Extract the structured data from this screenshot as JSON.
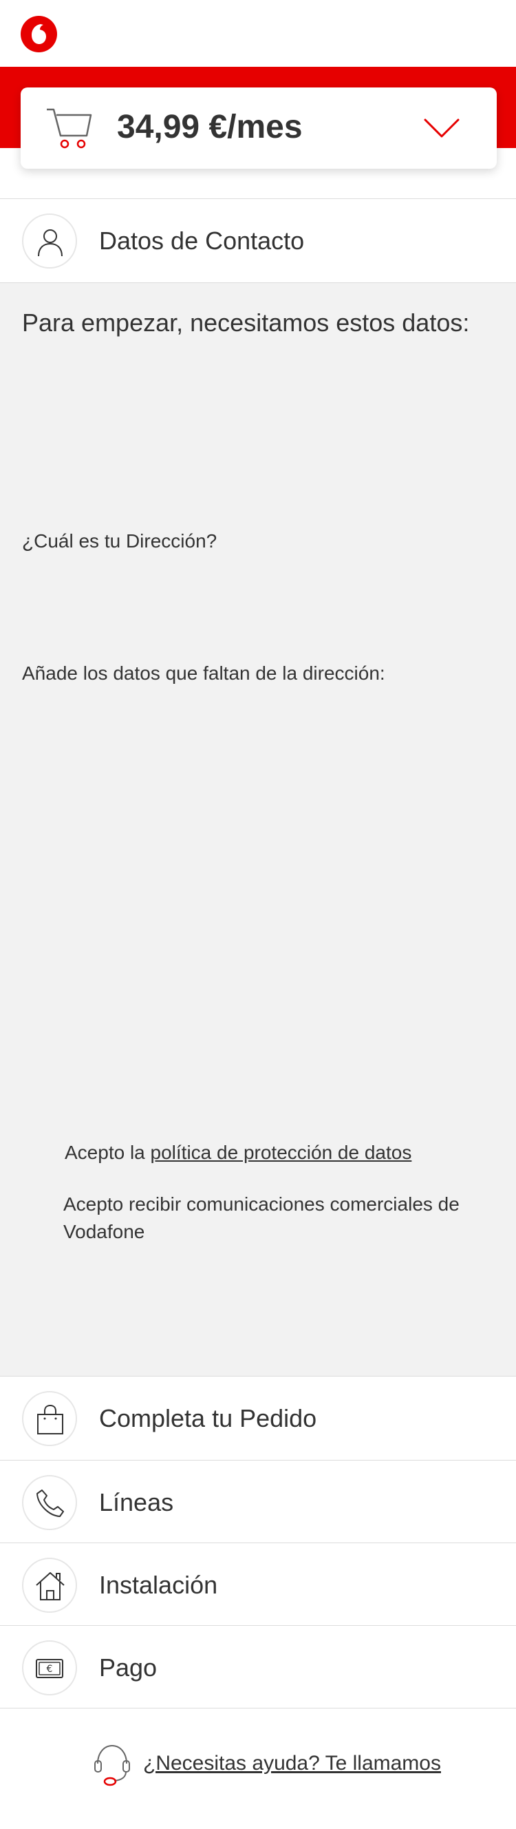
{
  "header": {
    "logo_icon": "vodafone-logo",
    "brand_color": "#e60000"
  },
  "summary": {
    "price": "34,99 €/mes",
    "cart_icon": "cart-icon",
    "toggle_icon": "chevron-down-icon"
  },
  "steps": {
    "contact": {
      "label": "Datos de Contacto",
      "icon": "user-icon"
    },
    "order": {
      "label": "Completa tu Pedido",
      "icon": "shopping-bag-icon"
    },
    "lines": {
      "label": "Líneas",
      "icon": "phone-icon"
    },
    "install": {
      "label": "Instalación",
      "icon": "home-icon"
    },
    "payment": {
      "label": "Pago",
      "icon": "euro-card-icon"
    }
  },
  "form": {
    "intro": "Para empezar, necesitamos estos datos:",
    "address_question": "¿Cuál es tu Dirección?",
    "missing_address": "Añade los datos que faltan de la dirección:",
    "accept_prefix": "Acepto la",
    "privacy_link": "política de protección de datos",
    "accept_comms": "Acepto recibir comunicaciones comerciales de Vodafone"
  },
  "help": {
    "icon": "headset-icon",
    "link": "¿Necesitas ayuda? Te llamamos"
  }
}
